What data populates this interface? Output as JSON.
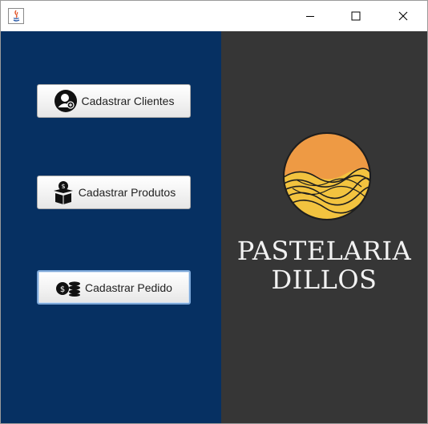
{
  "window": {
    "title": "",
    "controls": [
      "minimize-icon",
      "maximize-icon",
      "close-icon"
    ]
  },
  "menu": {
    "buttons": [
      {
        "label": "Cadastrar Clientes",
        "icon": "add-user-icon"
      },
      {
        "label": "Cadastrar Produtos",
        "icon": "money-box-icon"
      },
      {
        "label": "Cadastrar Pedido",
        "icon": "coins-icon"
      }
    ]
  },
  "brand": {
    "line1": "PASTELARIA",
    "line2": "DILLOS",
    "colors": {
      "sun_top": "#EE9A44",
      "sun_bottom": "#F2C33F",
      "left_panel": "#063062",
      "right_panel": "#363636"
    }
  }
}
